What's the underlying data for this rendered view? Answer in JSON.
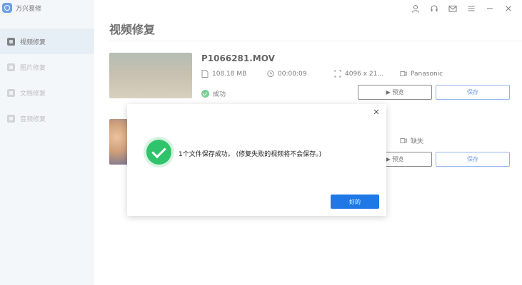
{
  "app": {
    "name": "万兴易修"
  },
  "sidebar": {
    "items": [
      {
        "label": "视频修复",
        "active": true
      },
      {
        "label": "图片修复",
        "active": false
      },
      {
        "label": "文档修复",
        "active": false
      },
      {
        "label": "音频修复",
        "active": false
      }
    ]
  },
  "page": {
    "title": "视频修复"
  },
  "files": [
    {
      "name": "P1066281.MOV",
      "size": "108.18 MB",
      "duration": "00:00:09",
      "resolution": "4096 x 21...",
      "camera": "Panasonic",
      "status": "成功",
      "preview_label": "▶ 预览",
      "save_label": "保存"
    },
    {
      "camera": "缺失",
      "preview_label": "▶ 预览",
      "save_label": "保存"
    }
  ],
  "dialog": {
    "message": "1个文件保存成功。 (修复失败的视频将不会保存。)",
    "ok_label": "好的",
    "close_glyph": "✕"
  },
  "colors": {
    "accent": "#1f78e6",
    "success": "#2fc36b",
    "sidebar_bg": "#eef3f8"
  }
}
